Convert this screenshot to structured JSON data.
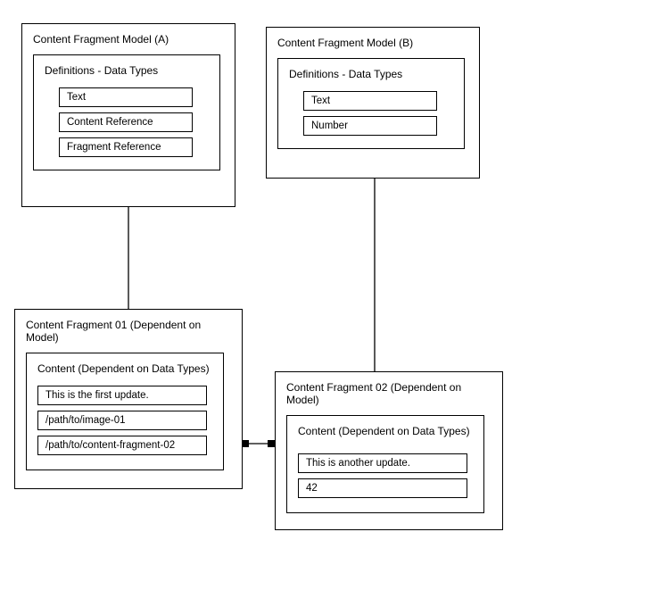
{
  "modelA": {
    "title": "Content Fragment Model (A)",
    "defs_title": "Definitions - Data Types",
    "types": [
      "Text",
      "Content Reference",
      "Fragment Reference"
    ]
  },
  "modelB": {
    "title": "Content Fragment Model (B)",
    "defs_title": "Definitions - Data Types",
    "types": [
      "Text",
      "Number"
    ]
  },
  "fragment1": {
    "title": "Content Fragment  01 (Dependent on Model)",
    "content_title": "Content (Dependent on Data Types)",
    "values": [
      "This is the first update.",
      "/path/to/image-01",
      "/path/to/content-fragment-02"
    ]
  },
  "fragment2": {
    "title": "Content Fragment 02 (Dependent on Model)",
    "content_title": "Content  (Dependent on Data Types)",
    "values": [
      "This is another update.",
      "42"
    ]
  }
}
